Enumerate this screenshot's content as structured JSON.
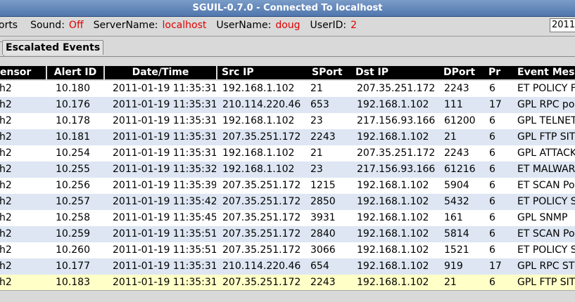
{
  "window": {
    "title": "SGUIL-0.7.0 - Connected To localhost"
  },
  "status": {
    "reports_fragment": "orts",
    "sound_label": "Sound:",
    "sound_value": "Off",
    "server_label": "ServerName:",
    "server_value": "localhost",
    "user_label": "UserName:",
    "user_value": "doug",
    "userid_label": "UserID:",
    "userid_value": "2",
    "date_fragment": "2011-"
  },
  "tabs": {
    "escalated": "Escalated Events"
  },
  "table": {
    "headers": [
      "ensor",
      "Alert ID",
      "Date/Time",
      "Src IP",
      "SPort",
      "Dst IP",
      "DPort",
      "Pr",
      "Event Messa"
    ],
    "rows": [
      [
        "h2",
        "10.180",
        "2011-01-19 11:35:31",
        "192.168.1.102",
        "21",
        "207.35.251.172",
        "2243",
        "6",
        "ET POLICY F"
      ],
      [
        "h2",
        "10.176",
        "2011-01-19 11:35:31",
        "210.114.220.46",
        "653",
        "192.168.1.102",
        "111",
        "17",
        "GPL RPC po"
      ],
      [
        "h2",
        "10.178",
        "2011-01-19 11:35:31",
        "192.168.1.102",
        "23",
        "217.156.93.166",
        "61200",
        "6",
        "GPL TELNET"
      ],
      [
        "h2",
        "10.181",
        "2011-01-19 11:35:31",
        "207.35.251.172",
        "2243",
        "192.168.1.102",
        "21",
        "6",
        "GPL FTP SIT"
      ],
      [
        "h2",
        "10.254",
        "2011-01-19 11:35:31",
        "192.168.1.102",
        "21",
        "207.35.251.172",
        "2243",
        "6",
        "GPL ATTACK"
      ],
      [
        "h2",
        "10.255",
        "2011-01-19 11:35:32",
        "192.168.1.102",
        "23",
        "217.156.93.166",
        "61216",
        "6",
        "ET MALWAR"
      ],
      [
        "h2",
        "10.256",
        "2011-01-19 11:35:39",
        "207.35.251.172",
        "1215",
        "192.168.1.102",
        "5904",
        "6",
        "ET SCAN Po"
      ],
      [
        "h2",
        "10.257",
        "2011-01-19 11:35:42",
        "207.35.251.172",
        "2850",
        "192.168.1.102",
        "5432",
        "6",
        "ET POLICY S"
      ],
      [
        "h2",
        "10.258",
        "2011-01-19 11:35:45",
        "207.35.251.172",
        "3931",
        "192.168.1.102",
        "161",
        "6",
        "GPL SNMP"
      ],
      [
        "h2",
        "10.259",
        "2011-01-19 11:35:51",
        "207.35.251.172",
        "2840",
        "192.168.1.102",
        "5814",
        "6",
        "ET SCAN Po"
      ],
      [
        "h2",
        "10.260",
        "2011-01-19 11:35:51",
        "207.35.251.172",
        "3066",
        "192.168.1.102",
        "1521",
        "6",
        "ET POLICY S"
      ],
      [
        "h2",
        "10.177",
        "2011-01-19 11:35:31",
        "210.114.220.46",
        "654",
        "192.168.1.102",
        "919",
        "17",
        "GPL RPC ST"
      ],
      [
        "h2",
        "10.183",
        "2011-01-19 11:35:31",
        "207.35.251.172",
        "2243",
        "192.168.1.102",
        "21",
        "6",
        "GPL FTP SIT"
      ]
    ]
  },
  "colors": {
    "row_white": "#ffffff",
    "row_alt": "#dde6f2",
    "row_selected": "#ffffc8",
    "status_value": "#e00000"
  }
}
